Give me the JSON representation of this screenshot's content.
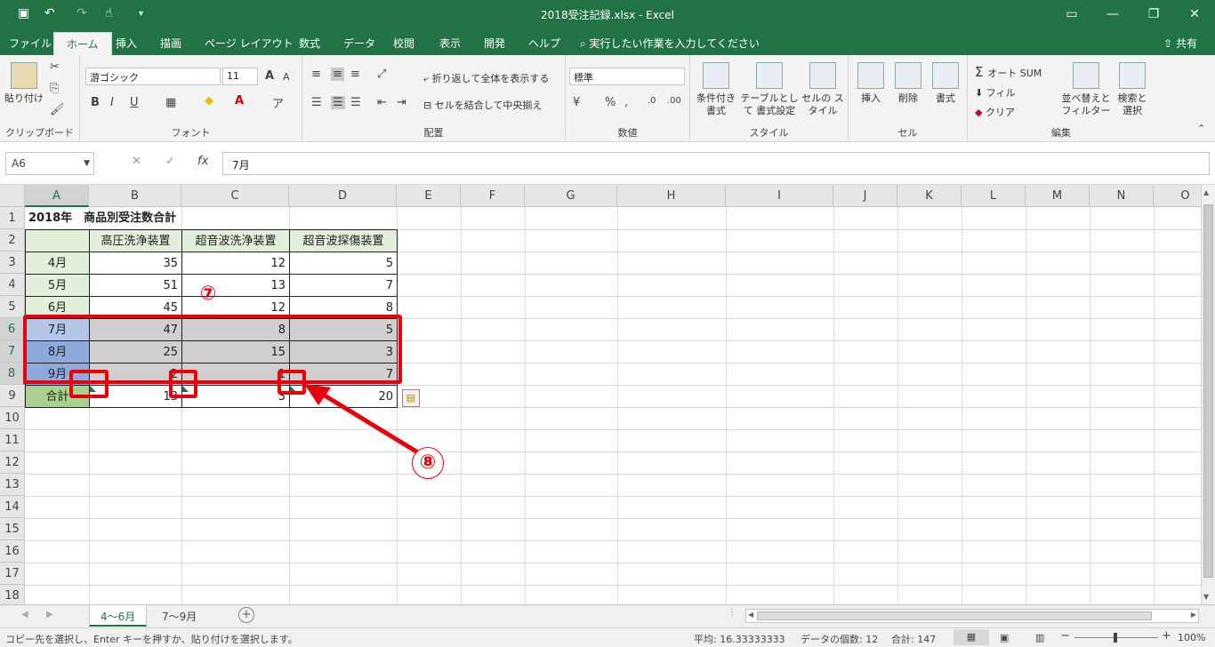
{
  "window": {
    "title": "2018受注記録.xlsx  -  Excel"
  },
  "menu": {
    "tabs": [
      "ファイル",
      "ホーム",
      "挿入",
      "描画",
      "ページ レイアウト",
      "数式",
      "データ",
      "校閲",
      "表示",
      "開発",
      "ヘルプ"
    ],
    "active": "ホーム",
    "tell_me": "実行したい作業を入力してください",
    "share": "共有"
  },
  "ribbon": {
    "clipboard": {
      "paste": "貼り付け",
      "label": "クリップボード"
    },
    "font": {
      "name": "游ゴシック",
      "size": "11",
      "label": "フォント",
      "bold": "B",
      "italic": "I",
      "underline": "U",
      "grow": "A",
      "shrink": "A"
    },
    "alignment": {
      "wrap": "折り返して全体を表示する",
      "merge": "セルを結合して中央揃え",
      "label": "配置"
    },
    "number": {
      "format": "標準",
      "label": "数値"
    },
    "styles": {
      "cond": "条件付き 書式",
      "table": "テーブルとして 書式設定",
      "cell": "セルの スタイル",
      "label": "スタイル"
    },
    "cells": {
      "insert": "挿入",
      "delete": "削除",
      "format": "書式",
      "label": "セル"
    },
    "editing": {
      "autosum": "オート SUM",
      "fill": "フィル",
      "clear": "クリア",
      "sort": "並べ替えと フィルター",
      "find": "検索と 選択",
      "label": "編集"
    }
  },
  "formula_bar": {
    "name_box": "A6",
    "cancel": "✕",
    "enter": "✓",
    "fx": "fx",
    "content": "7月"
  },
  "columns": [
    "A",
    "B",
    "C",
    "D",
    "E",
    "F",
    "G",
    "H",
    "I",
    "J",
    "K",
    "L",
    "M",
    "N",
    "O"
  ],
  "rows": [
    "1",
    "2",
    "3",
    "4",
    "5",
    "6",
    "7",
    "8",
    "9",
    "10",
    "11",
    "12",
    "13",
    "14",
    "15",
    "16",
    "17",
    "18"
  ],
  "sheet": {
    "title": "2018年　商品別受注数合計",
    "headers": [
      "高圧洗浄装置",
      "超音波洗浄装置",
      "超音波探傷装置"
    ],
    "data": [
      [
        "4月",
        "35",
        "12",
        "5"
      ],
      [
        "5月",
        "51",
        "13",
        "7"
      ],
      [
        "6月",
        "45",
        "12",
        "8"
      ],
      [
        "7月",
        "47",
        "8",
        "5"
      ],
      [
        "8月",
        "25",
        "15",
        "3"
      ],
      [
        "9月",
        "2",
        "1",
        "7"
      ]
    ],
    "total_label": "合計",
    "totals": [
      "13",
      "3",
      "20"
    ]
  },
  "annotations": {
    "a7": "⑦",
    "a8": "⑧"
  },
  "sheet_tabs": [
    "4～6月",
    "7～9月"
  ],
  "active_sheet": "4～6月",
  "status": {
    "message": "コピー先を選択し、Enter キーを押すか、貼り付けを選択します。",
    "average": "平均: 16.33333333",
    "count": "データの個数: 12",
    "sum": "合計: 147",
    "zoom": "100%"
  },
  "colors": {
    "excel_green": "#217346",
    "header_fill": "#e2efda",
    "highlight_red": "#e8000b"
  }
}
